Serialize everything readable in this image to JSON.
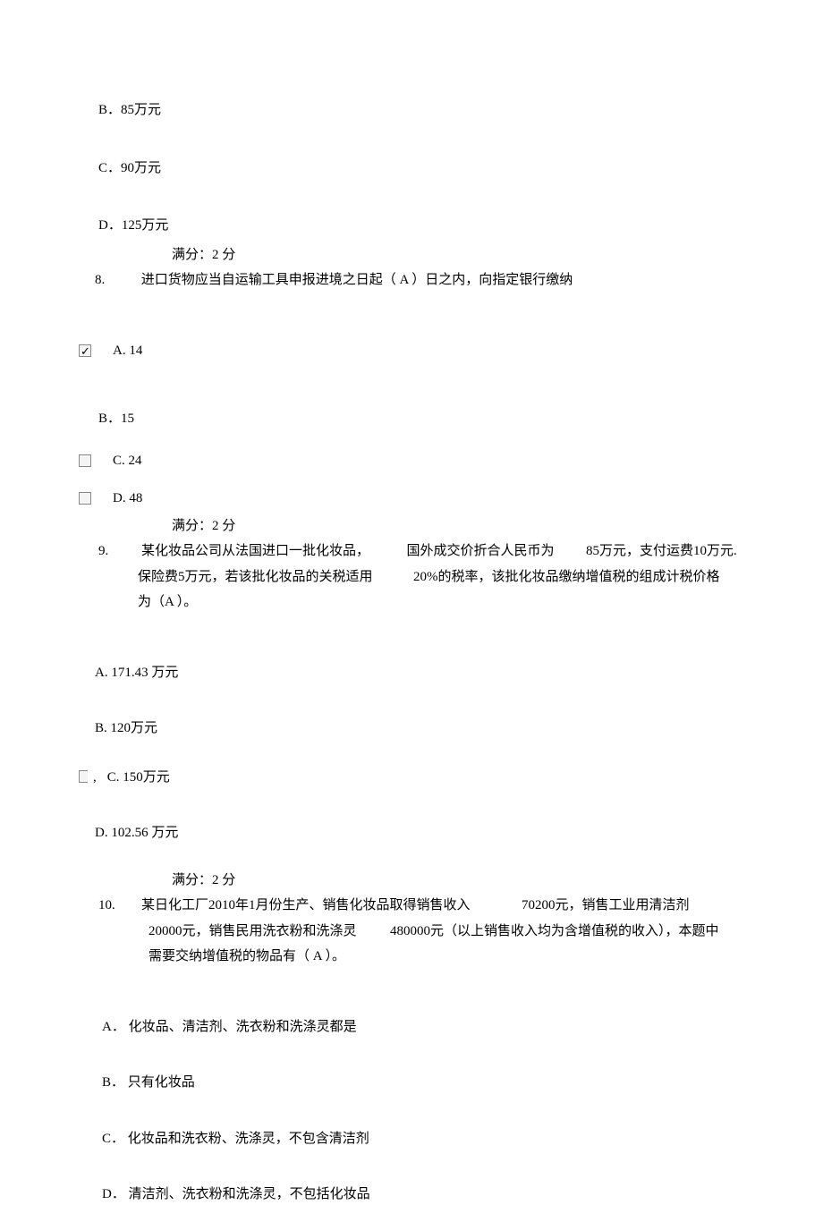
{
  "q7": {
    "optB": "B．85万元",
    "optC": "C．90万元",
    "optD": "D．125万元"
  },
  "score": "满分：2 分",
  "q8": {
    "num": "8.",
    "text": "进口货物应当自运输工具申报进境之日起（ A ）日之内，向指定银行缴纳",
    "optA": "A. 14",
    "optB": "B．15",
    "optC": "C. 24",
    "optD": "D. 48"
  },
  "q9": {
    "num": "9.",
    "seg1": "某化妆品公司从法国进口一批化妆品，",
    "seg2": "国外成交价折合人民币为",
    "seg3": "85万元，支付运费10万元.",
    "line2a": "保险费5万元，若该批化妆品的关税适用",
    "line2b": "20%的税率，该批化妆品缴纳增值税的组成计税价格",
    "line3": "为（A ）。",
    "optA": "A. 171.43 万元",
    "optB": "B. 120万元",
    "optC_prefix": ",",
    "optC": "C. 150万元",
    "optD": "D. 102.56 万元"
  },
  "q10": {
    "num": "10.",
    "seg1": "某日化工厂2010年1月份生产、销售化妆品取得销售收入",
    "seg2": "70200元，销售工业用清洁剂",
    "line2a": "20000元，销售民用洗衣粉和洗涤灵",
    "line2b": "480000元（以上销售收入均为含增值税的收入），本题中",
    "line3": "需要交纳增值税的物品有（ A ）。",
    "optA": "A． 化妆品、清洁剂、洗衣粉和洗涤灵都是",
    "optB": "B． 只有化妆品",
    "optC": "C． 化妆品和洗衣粉、洗涤灵，不包含清洁剂",
    "optD": "D． 清洁剂、洗衣粉和洗涤灵，不包括化妆品"
  }
}
